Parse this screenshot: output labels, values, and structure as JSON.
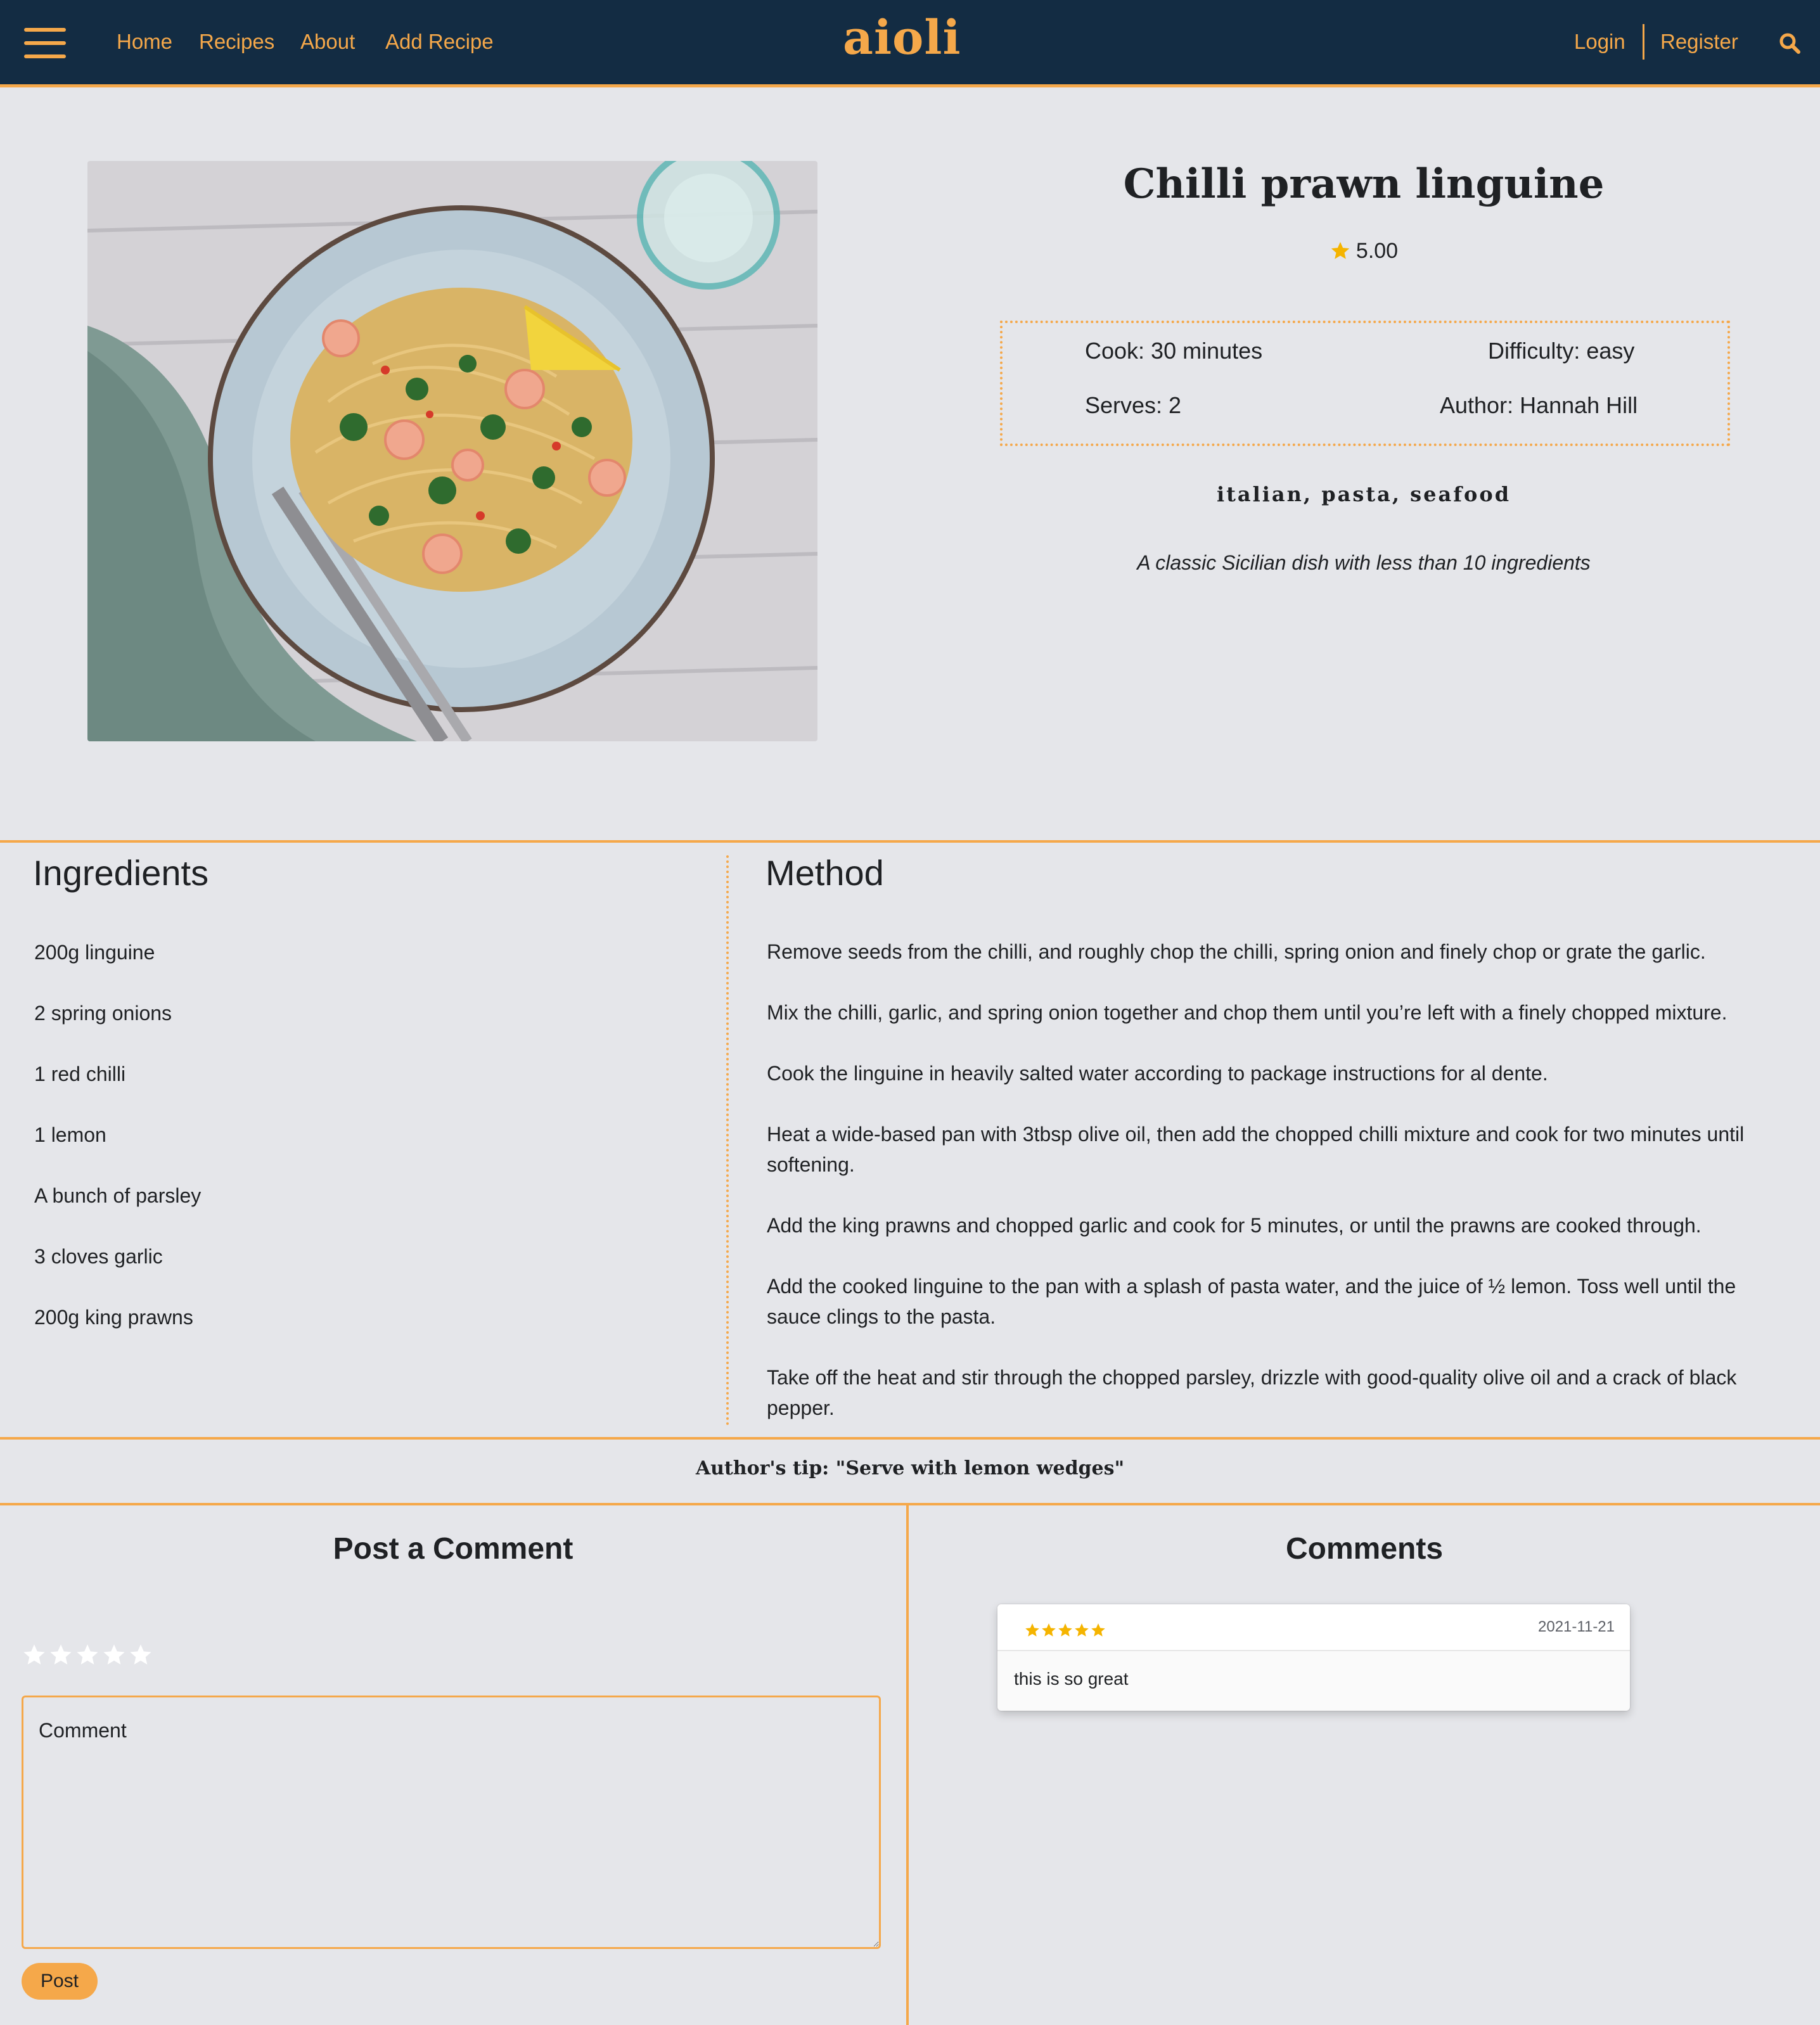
{
  "nav": {
    "links": [
      "Home",
      "Recipes",
      "About",
      "Add Recipe"
    ],
    "brand": "aioli",
    "login": "Login",
    "register": "Register"
  },
  "recipe": {
    "title": "Chilli prawn linguine",
    "rating": "5.00",
    "cook": "Cook: 30 minutes",
    "difficulty": "Difficulty: easy",
    "serves": "Serves: 2",
    "author": "Author: Hannah Hill",
    "tags": "italian, pasta, seafood",
    "description": "A classic Sicilian dish with less than 10 ingredients"
  },
  "ingredients": {
    "heading": "Ingredients",
    "items": [
      "200g linguine",
      "2 spring onions",
      "1 red chilli",
      "1 lemon",
      "A bunch of parsley",
      "3 cloves garlic",
      "200g king prawns"
    ]
  },
  "method": {
    "heading": "Method",
    "steps": [
      "Remove seeds from the chilli, and roughly chop the chilli, spring onion and finely chop or grate the garlic.",
      "Mix the chilli, garlic, and spring onion together and chop them until you’re left with a finely chopped mixture.",
      "Cook the linguine in heavily salted water according to package instructions for al dente.",
      "Heat a wide-based pan with 3tbsp olive oil, then add the chopped chilli mixture and cook for two minutes until softening.",
      "Add the king prawns and chopped garlic and cook for 5 minutes, or until the prawns are cooked through.",
      "Add the cooked linguine to the pan with a splash of pasta water, and the juice of ½ lemon. Toss well until the sauce clings to the pasta.",
      "Take off the heat and stir through the chopped parsley, drizzle with good-quality olive oil and a crack of black pepper."
    ]
  },
  "tip": "Author's tip: \"Serve with lemon wedges\"",
  "post_comment": {
    "heading": "Post a Comment",
    "placeholder": "Comment",
    "button": "Post",
    "selected_stars": 0
  },
  "comments": {
    "heading": "Comments",
    "items": [
      {
        "stars": 5,
        "date": "2021-11-21",
        "text": "this is so great"
      }
    ]
  },
  "colors": {
    "navy": "#132c43",
    "accent": "#f5a84a",
    "background": "#e5e6ea",
    "star": "#f5b400"
  },
  "icons": [
    "hamburger-menu-icon",
    "search-icon",
    "star-icon"
  ]
}
